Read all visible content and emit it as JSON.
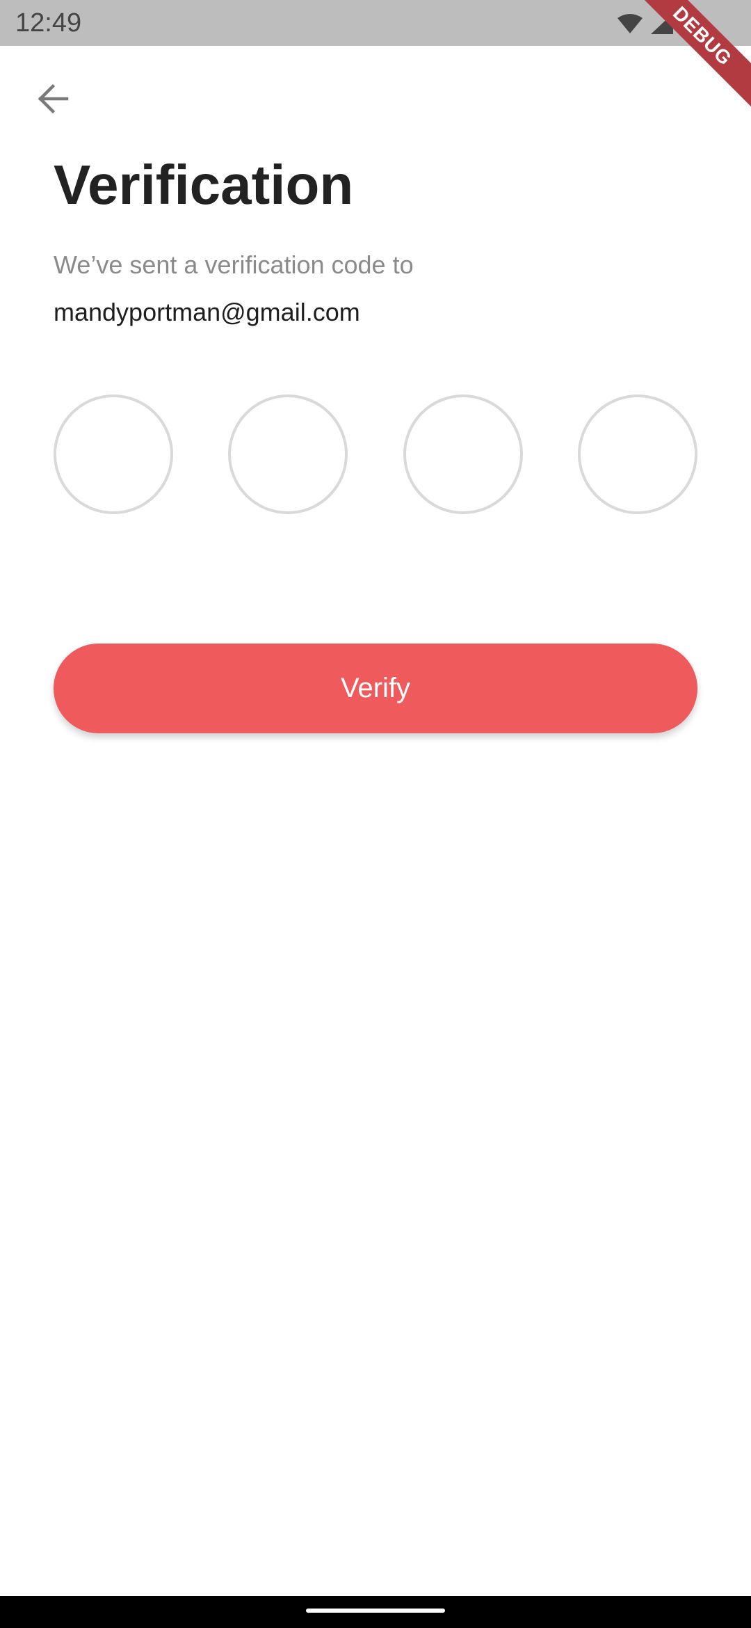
{
  "status_bar": {
    "time": "12:49"
  },
  "debug_banner": {
    "label": "DEBUG"
  },
  "header": {
    "back_icon": "arrow-left-icon"
  },
  "title": "Verification",
  "subtitle": "We’ve sent a verification code to",
  "email": "mandyportman@gmail.com",
  "otp": {
    "digits": [
      "",
      "",
      "",
      ""
    ]
  },
  "verify_button": {
    "label": "Verify"
  },
  "colors": {
    "accent": "#ef5a5c",
    "circle_border": "#d9d9d9",
    "status_bar": "#bdbdbd",
    "debug_ribbon": "#b23b41"
  }
}
